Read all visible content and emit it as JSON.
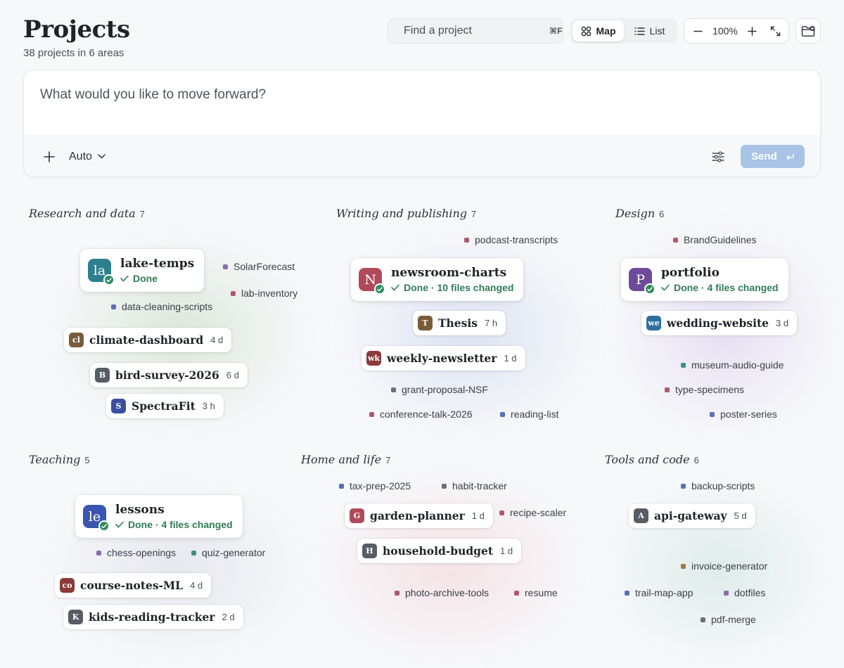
{
  "header": {
    "title": "Projects",
    "subtitle": "38 projects in 6 areas",
    "search": {
      "placeholder": "Find a project",
      "shortcut": "⌘F",
      "icon": "search-icon"
    },
    "view_toggle": {
      "map_label": "Map",
      "list_label": "List",
      "active": "map"
    },
    "zoom": {
      "value": "100%"
    }
  },
  "composer": {
    "placeholder": "What would you like to move forward?",
    "mode_label": "Auto",
    "send_label": "Send"
  },
  "colors": {
    "accent": "#a9c3e6",
    "done_green": "#2f7d55"
  },
  "areas": [
    {
      "title": "Research and data",
      "count": "7",
      "cards": [
        {
          "initials": "la",
          "name": "lake-temps",
          "status": "Done",
          "color": "#2d7f8e"
        }
      ],
      "pills": [
        {
          "initials": "cl",
          "name": "climate-dashboard",
          "age": "4 d",
          "color": "#7a5b3a"
        },
        {
          "initials": "B",
          "name": "bird-survey-2026",
          "age": "6 d",
          "color": "#565d66"
        },
        {
          "initials": "S",
          "name": "SpectraFit",
          "age": "3 h",
          "color": "#3a4fa0"
        }
      ],
      "tags": [
        {
          "name": "SolarForecast",
          "color": "#8a6db0"
        },
        {
          "name": "lab-inventory",
          "color": "#b05a6a"
        },
        {
          "name": "data-cleaning-scripts",
          "color": "#5a6fb5"
        }
      ]
    },
    {
      "title": "Writing and publishing",
      "count": "7",
      "cards": [
        {
          "initials": "N",
          "name": "newsroom-charts",
          "status": "Done · 10 files changed",
          "color": "#b04a5a"
        }
      ],
      "pills": [
        {
          "initials": "T",
          "name": "Thesis",
          "age": "7 h",
          "color": "#7a5b3a"
        },
        {
          "initials": "wk",
          "name": "weekly-newsletter",
          "age": "1 d",
          "color": "#8a3a3a"
        }
      ],
      "tags": [
        {
          "name": "podcast-transcripts",
          "color": "#b05a6a"
        },
        {
          "name": "grant-proposal-NSF",
          "color": "#6a6f78"
        },
        {
          "name": "conference-talk-2026",
          "color": "#b05a6a"
        },
        {
          "name": "reading-list",
          "color": "#5a6fb5"
        }
      ]
    },
    {
      "title": "Design",
      "count": "6",
      "cards": [
        {
          "initials": "P",
          "name": "portfolio",
          "status": "Done · 4 files changed",
          "color": "#6d4a9a"
        }
      ],
      "pills": [
        {
          "initials": "we",
          "name": "wedding-website",
          "age": "3 d",
          "color": "#2d6fa0"
        }
      ],
      "tags": [
        {
          "name": "BrandGuidelines",
          "color": "#b05a6a"
        },
        {
          "name": "museum-audio-guide",
          "color": "#3f8f8a"
        },
        {
          "name": "type-specimens",
          "color": "#b05a6a"
        },
        {
          "name": "poster-series",
          "color": "#5a6fb5"
        }
      ]
    },
    {
      "title": "Teaching",
      "count": "5",
      "cards": [
        {
          "initials": "le",
          "name": "lessons",
          "status": "Done · 4 files changed",
          "color": "#3a56b0"
        }
      ],
      "pills": [
        {
          "initials": "co",
          "name": "course-notes-ML",
          "age": "4 d",
          "color": "#8a3a3a"
        },
        {
          "initials": "K",
          "name": "kids-reading-tracker",
          "age": "2 d",
          "color": "#565d66"
        }
      ],
      "tags": [
        {
          "name": "chess-openings",
          "color": "#8a6db0"
        },
        {
          "name": "quiz-generator",
          "color": "#3f8f8a"
        }
      ]
    },
    {
      "title": "Home and life",
      "count": "7",
      "cards": [],
      "pills": [
        {
          "initials": "G",
          "name": "garden-planner",
          "age": "1 d",
          "color": "#b04a5a"
        },
        {
          "initials": "H",
          "name": "household-budget",
          "age": "1 d",
          "color": "#565d66"
        }
      ],
      "tags": [
        {
          "name": "tax-prep-2025",
          "color": "#5a6fb5"
        },
        {
          "name": "habit-tracker",
          "color": "#6a6f78"
        },
        {
          "name": "recipe-scaler",
          "color": "#b05a6a"
        },
        {
          "name": "photo-archive-tools",
          "color": "#b05a6a"
        },
        {
          "name": "resume",
          "color": "#b05a6a"
        }
      ]
    },
    {
      "title": "Tools and code",
      "count": "6",
      "cards": [],
      "pills": [
        {
          "initials": "A",
          "name": "api-gateway",
          "age": "5 d",
          "color": "#565d66"
        }
      ],
      "tags": [
        {
          "name": "backup-scripts",
          "color": "#5a6fb5"
        },
        {
          "name": "invoice-generator",
          "color": "#a0784a"
        },
        {
          "name": "trail-map-app",
          "color": "#5a6fb5"
        },
        {
          "name": "dotfiles",
          "color": "#8a6db0"
        },
        {
          "name": "pdf-merge",
          "color": "#6a6f78"
        }
      ]
    }
  ]
}
